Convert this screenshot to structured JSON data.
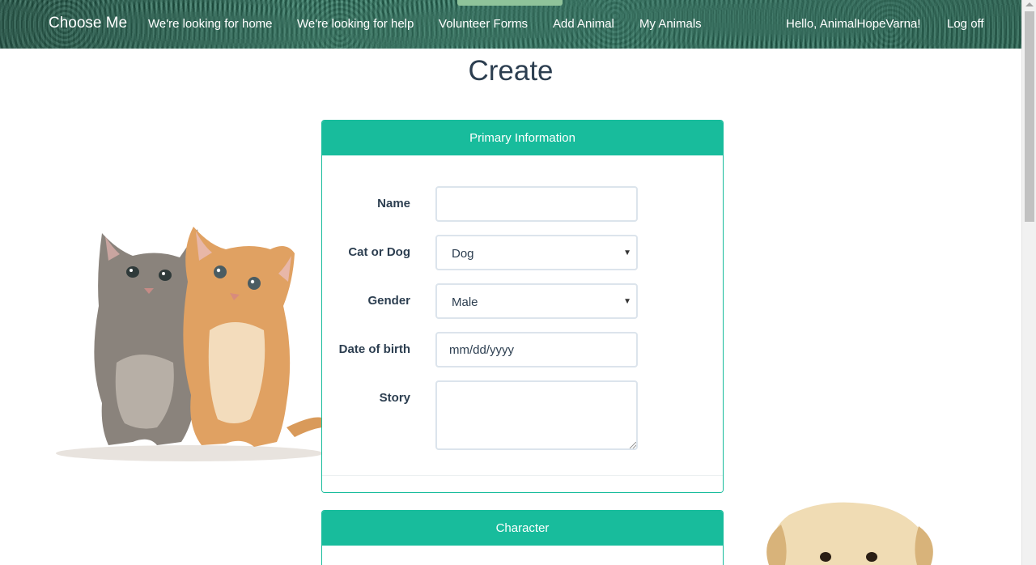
{
  "navbar": {
    "brand": "Choose Me",
    "links": [
      {
        "label": "We're looking for home"
      },
      {
        "label": "We're looking for help"
      },
      {
        "label": "Volunteer Forms"
      },
      {
        "label": "Add Animal"
      },
      {
        "label": "My Animals"
      }
    ],
    "greeting": "Hello, AnimalHopeVarna!",
    "logoff": "Log off"
  },
  "page": {
    "title": "Create"
  },
  "primary_panel": {
    "heading": "Primary Information",
    "fields": {
      "name": {
        "label": "Name",
        "value": ""
      },
      "species": {
        "label": "Cat or Dog",
        "value": "Dog"
      },
      "gender": {
        "label": "Gender",
        "value": "Male"
      },
      "dob": {
        "label": "Date of birth",
        "placeholder": "mm/dd/yyyy"
      },
      "story": {
        "label": "Story",
        "value": ""
      }
    }
  },
  "character_panel": {
    "heading": "Character"
  },
  "colors": {
    "accent": "#18bc9c",
    "text": "#2c3e50",
    "input_border": "#dce4ec"
  },
  "icons": {
    "dropdown_caret": "caret-down-icon",
    "textarea_resize": "resize-grip-icon"
  }
}
